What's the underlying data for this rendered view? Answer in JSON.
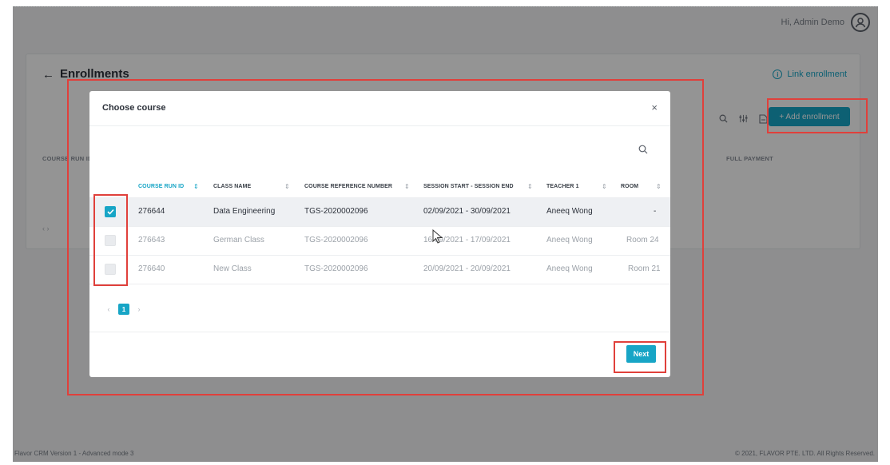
{
  "topbar": {
    "greeting": "Hi, Admin Demo",
    "avatar_icon": "user-circle-icon"
  },
  "page": {
    "title": "Enrollments",
    "link_enrollment": "Link enrollment",
    "add_enrollment": "+ Add enrollment",
    "bg_columns": [
      "COURSE RUN ID",
      "FULL PAYMENT"
    ],
    "bg_pager": "‹ ›"
  },
  "footer": {
    "left": "Flavor CRM Version 1 - Advanced mode 3",
    "right": "© 2021, FLAVOR PTE. LTD. All Rights Reserved."
  },
  "modal": {
    "title": "Choose course",
    "close": "×",
    "columns": [
      "COURSE RUN ID",
      "CLASS NAME",
      "COURSE REFERENCE NUMBER",
      "SESSION START - SESSION END",
      "TEACHER 1",
      "ROOM"
    ],
    "rows": [
      {
        "checked": true,
        "run_id": "276644",
        "class_name": "Data Engineering",
        "ref": "TGS-2020002096",
        "session": "02/09/2021 - 30/09/2021",
        "teacher": "Aneeq Wong",
        "room": "-"
      },
      {
        "checked": false,
        "run_id": "276643",
        "class_name": "German Class",
        "ref": "TGS-2020002096",
        "session": "16/09/2021 - 17/09/2021",
        "teacher": "Aneeq Wong",
        "room": "Room 24"
      },
      {
        "checked": false,
        "run_id": "276640",
        "class_name": "New Class",
        "ref": "TGS-2020002096",
        "session": "20/09/2021 - 20/09/2021",
        "teacher": "Aneeq Wong",
        "room": "Room 21"
      }
    ],
    "pagination": {
      "prev": "‹",
      "current": "1",
      "next": "›"
    },
    "next_button": "Next"
  },
  "colors": {
    "accent": "#17a5c6",
    "highlight": "#e0403b"
  }
}
